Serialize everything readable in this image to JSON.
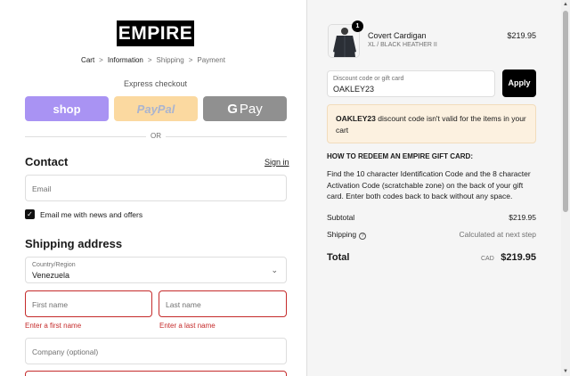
{
  "brand": {
    "logo_text": "EMPIRE"
  },
  "breadcrumb": {
    "items": [
      "Cart",
      "Information",
      "Shipping",
      "Payment"
    ],
    "separator": ">"
  },
  "express": {
    "label": "Express checkout",
    "shop_label": "shop",
    "paypal_label": "PayPal",
    "gpay_g": "G",
    "gpay_label": "Pay"
  },
  "divider": {
    "or_label": "OR"
  },
  "contact": {
    "heading": "Contact",
    "signin_link": "Sign in",
    "email_placeholder": "Email",
    "newsletter_label": "Email me with news and offers",
    "newsletter_checked": true
  },
  "shipping": {
    "heading": "Shipping address",
    "country_label": "Country/Region",
    "country_value": "Venezuela",
    "first_name_placeholder": "First name",
    "last_name_placeholder": "Last name",
    "first_name_error": "Enter a first name",
    "last_name_error": "Enter a last name",
    "company_placeholder": "Company (optional)"
  },
  "order": {
    "quantity_badge": "1",
    "product_name": "Covert Cardigan",
    "product_variant": "XL / BLACK HEATHER II",
    "product_price": "$219.95",
    "discount_label": "Discount code or gift card",
    "discount_value": "OAKLEY23",
    "apply_label": "Apply",
    "warning_code": "OAKLEY23",
    "warning_text": " discount code isn't valid for the items in your cart",
    "redeem_heading": "HOW TO REDEEM AN EMPIRE GIFT CARD:",
    "redeem_text": "Find the 10 character Identification Code and the 8 character Activation Code (scratchable zone) on the back of your gift card. Enter both codes back to back without any space.",
    "subtotal_label": "Subtotal",
    "subtotal_value": "$219.95",
    "shipping_label": "Shipping",
    "shipping_value": "Calculated at next step",
    "total_label": "Total",
    "total_currency": "CAD",
    "total_value": "$219.95"
  },
  "colors": {
    "shop_pay": "#a993f3",
    "paypal": "#fbd9a0",
    "gpay": "#909090",
    "error": "#c52b2b",
    "warning_bg": "#fcf1e0"
  },
  "icons": {
    "checkbox": "check-icon",
    "country_chevron": "chevron-down-icon",
    "shipping_help": "question-circle-icon"
  }
}
